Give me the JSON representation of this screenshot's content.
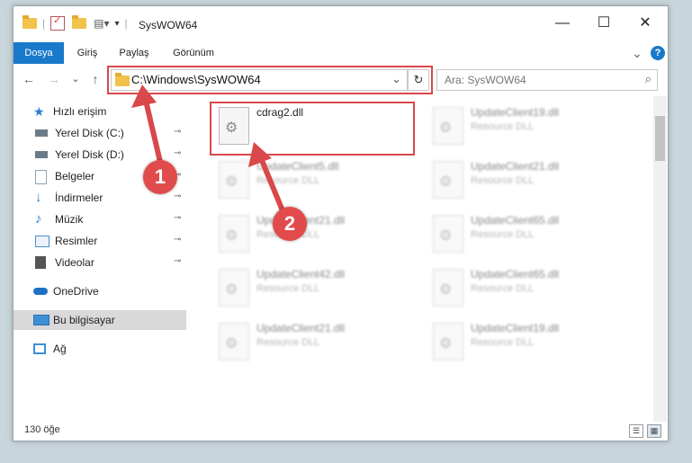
{
  "window": {
    "title": "SysWOW64"
  },
  "window_controls": {
    "minimize": "—",
    "maximize": "☐",
    "close": "✕"
  },
  "ribbon": {
    "tabs": [
      {
        "label": "Dosya",
        "active": true
      },
      {
        "label": "Giriş",
        "active": false
      },
      {
        "label": "Paylaş",
        "active": false
      },
      {
        "label": "Görünüm",
        "active": false
      }
    ],
    "expand_icon": "⌄",
    "help_icon": "?"
  },
  "nav": {
    "back": "←",
    "forward": "→",
    "recent": "⌄",
    "up": "↑",
    "address": "C:\\Windows\\SysWOW64",
    "dropdown": "⌄",
    "refresh": "↻",
    "search_placeholder": "Ara: SysWOW64",
    "search_icon": "⌕"
  },
  "sidebar": {
    "items": [
      {
        "label": "Hızlı erişim",
        "icon": "star-icon",
        "color": "#2b7fd4",
        "pinned": false
      },
      {
        "label": "Yerel Disk (C:)",
        "icon": "drive-icon",
        "color": "#6b7c89",
        "pinned": true
      },
      {
        "label": "Yerel Disk (D:)",
        "icon": "drive-icon",
        "color": "#6b7c89",
        "pinned": true
      },
      {
        "label": "Belgeler",
        "icon": "documents-icon",
        "color": "#8aa4bb",
        "pinned": true
      },
      {
        "label": "İndirmeler",
        "icon": "download-icon",
        "color": "#2b7fd4",
        "pinned": true
      },
      {
        "label": "Müzik",
        "icon": "music-icon",
        "color": "#2b7fd4",
        "pinned": true
      },
      {
        "label": "Resimler",
        "icon": "pictures-icon",
        "color": "#4a8fc7",
        "pinned": true
      },
      {
        "label": "Videolar",
        "icon": "videos-icon",
        "color": "#555555",
        "pinned": true
      },
      {
        "label": "OneDrive",
        "icon": "cloud-icon",
        "color": "#1f6fc4",
        "pinned": false
      },
      {
        "label": "Bu bilgisayar",
        "icon": "computer-icon",
        "color": "#3f8fd6",
        "pinned": false,
        "selected": true
      },
      {
        "label": "Ağ",
        "icon": "network-icon",
        "color": "#3f8fd6",
        "pinned": false
      }
    ],
    "pin_glyph": "📌"
  },
  "files": [
    {
      "name": "cdrag2.dll",
      "type": "",
      "blurred": false
    },
    {
      "name": "UpdateClient19.dll",
      "type": "Resource DLL",
      "blurred": true
    },
    {
      "name": "UpdateClient5.dll",
      "type": "Resource DLL",
      "blurred": true
    },
    {
      "name": "UpdateClient21.dll",
      "type": "Resource DLL",
      "blurred": true
    },
    {
      "name": "UpdateClient21.dll",
      "type": "Resource DLL",
      "blurred": true
    },
    {
      "name": "UpdateClient65.dll",
      "type": "Resource DLL",
      "blurred": true
    },
    {
      "name": "UpdateClient42.dll",
      "type": "Resource DLL",
      "blurred": true
    },
    {
      "name": "UpdateClient65.dll",
      "type": "Resource DLL",
      "blurred": true
    },
    {
      "name": "UpdateClient21.dll",
      "type": "Resource DLL",
      "blurred": true
    },
    {
      "name": "UpdateClient19.dll",
      "type": "Resource DLL",
      "blurred": true
    }
  ],
  "status": {
    "count": "130 öğe",
    "details_view": "☰",
    "icons_view": "▦"
  },
  "annotations": {
    "step1": "1",
    "step2": "2",
    "color": "#d9484a"
  }
}
